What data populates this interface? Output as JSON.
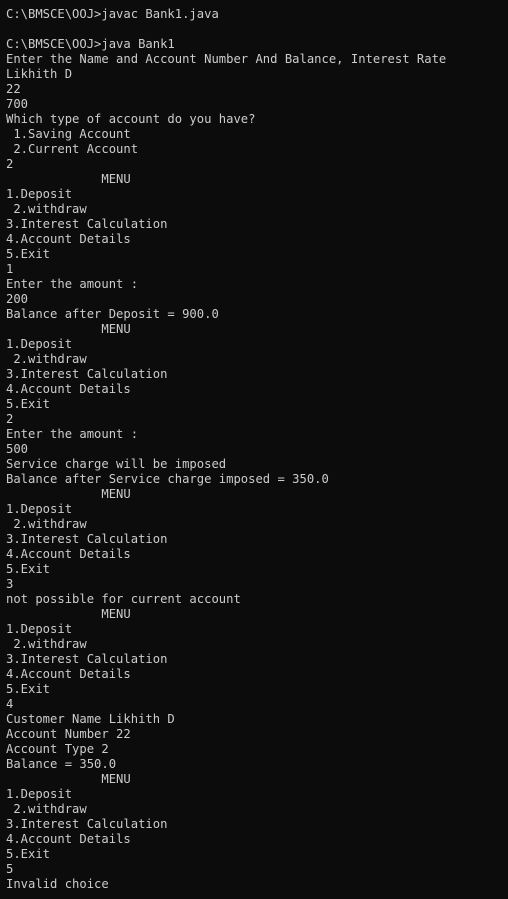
{
  "terminal": {
    "lines": [
      "C:\\BMSCE\\OOJ>javac Bank1.java",
      "",
      "C:\\BMSCE\\OOJ>java Bank1",
      "Enter the Name and Account Number And Balance, Interest Rate",
      "Likhith D",
      "22",
      "700",
      "Which type of account do you have?",
      " 1.Saving Account",
      " 2.Current Account",
      "2",
      "             MENU",
      "1.Deposit",
      " 2.withdraw",
      "3.Interest Calculation",
      "4.Account Details",
      "5.Exit",
      "1",
      "Enter the amount :",
      "200",
      "Balance after Deposit = 900.0",
      "             MENU",
      "1.Deposit",
      " 2.withdraw",
      "3.Interest Calculation",
      "4.Account Details",
      "5.Exit",
      "2",
      "Enter the amount :",
      "500",
      "Service charge will be imposed",
      "Balance after Service charge imposed = 350.0",
      "             MENU",
      "1.Deposit",
      " 2.withdraw",
      "3.Interest Calculation",
      "4.Account Details",
      "5.Exit",
      "3",
      "not possible for current account",
      "             MENU",
      "1.Deposit",
      " 2.withdraw",
      "3.Interest Calculation",
      "4.Account Details",
      "5.Exit",
      "4",
      "Customer Name Likhith D",
      "Account Number 22",
      "Account Type 2",
      "Balance = 350.0",
      "             MENU",
      "1.Deposit",
      " 2.withdraw",
      "3.Interest Calculation",
      "4.Account Details",
      "5.Exit",
      "5",
      "Invalid choice"
    ]
  },
  "colors": {
    "background": "#0c0c0c",
    "foreground": "#cccccc"
  }
}
